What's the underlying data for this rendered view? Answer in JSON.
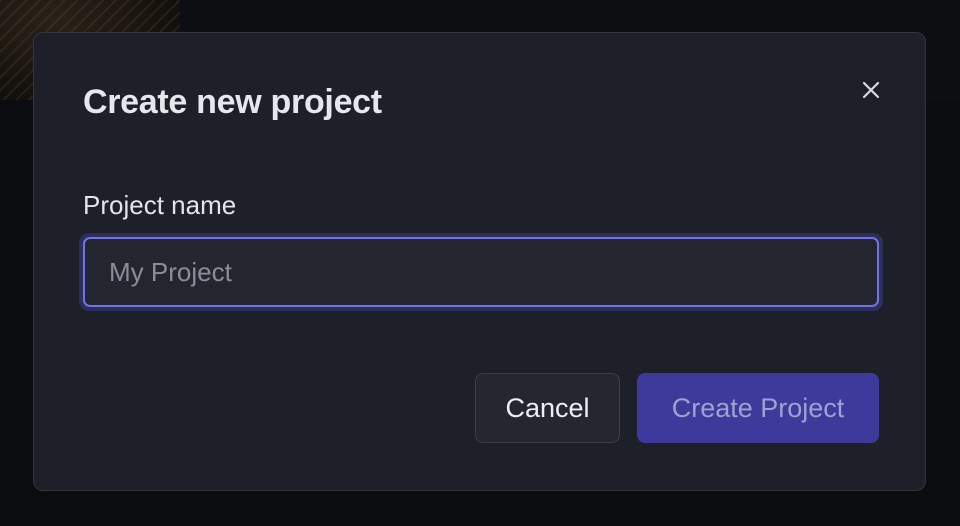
{
  "dialog": {
    "title": "Create new project",
    "close_icon": "close-icon"
  },
  "form": {
    "project_name": {
      "label": "Project name",
      "value": "",
      "placeholder": "My Project"
    }
  },
  "actions": {
    "cancel_label": "Cancel",
    "create_label": "Create Project",
    "create_disabled": true
  },
  "colors": {
    "accent": "#6f74e6",
    "primary_button": "#3d3a9c",
    "surface": "#1e2029"
  }
}
